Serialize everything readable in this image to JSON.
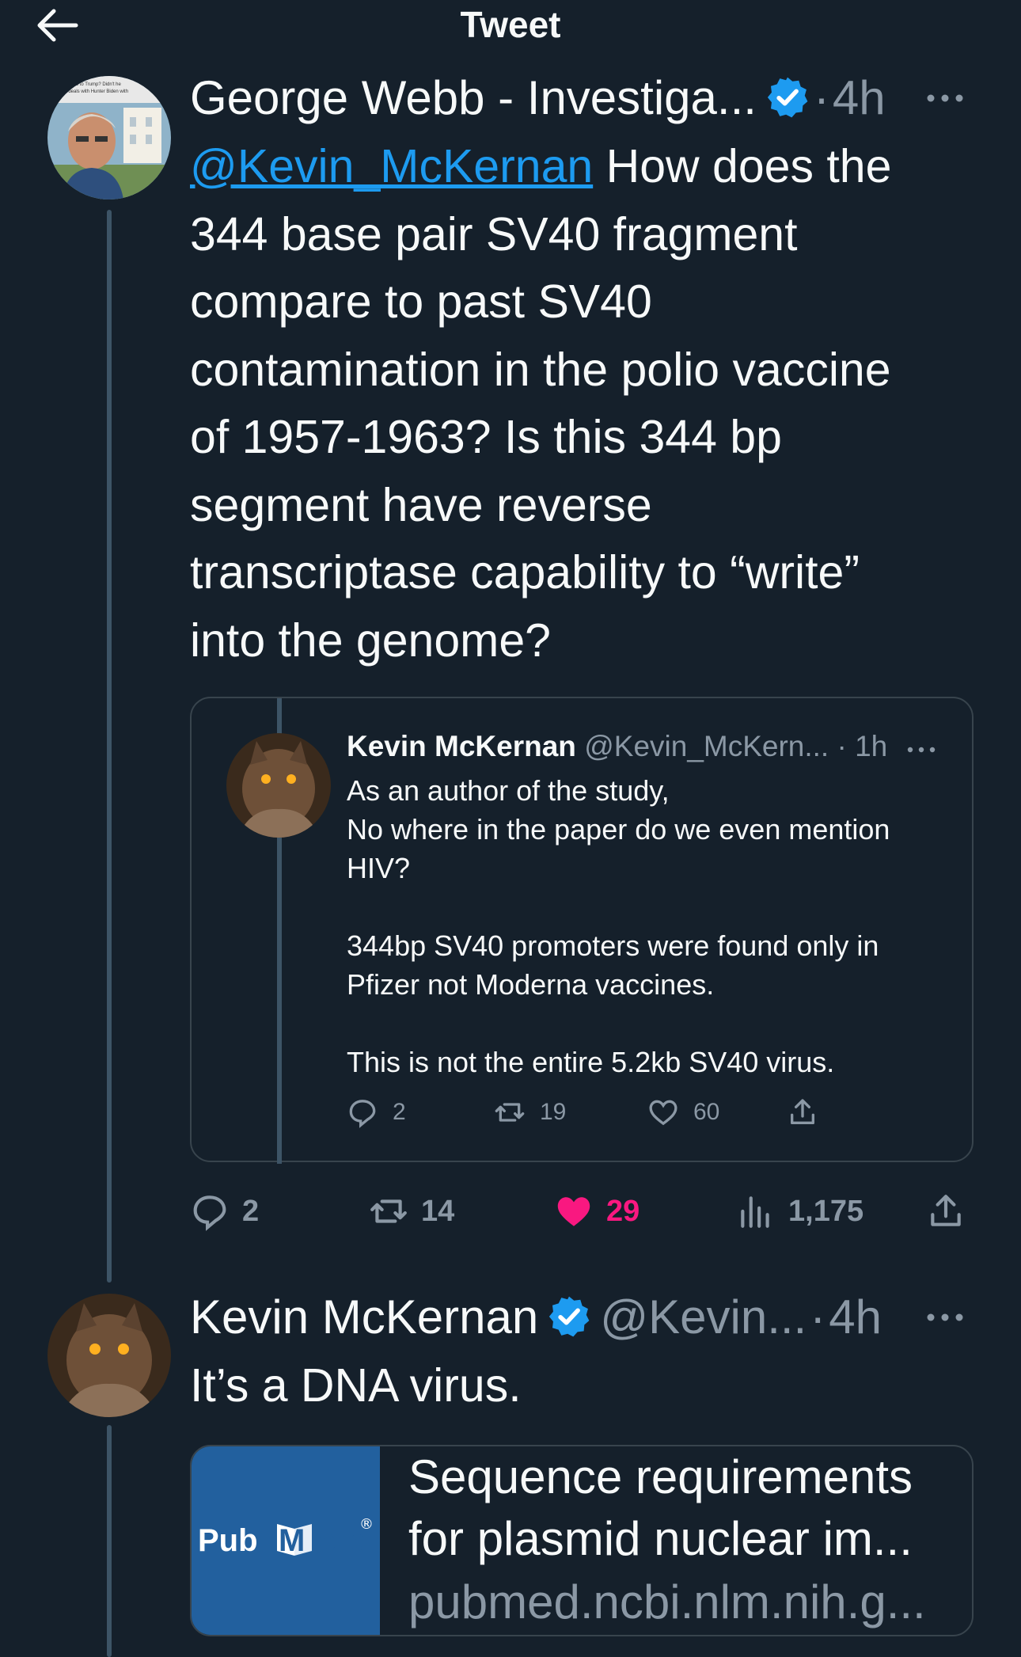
{
  "header": {
    "title": "Tweet",
    "back_icon": "arrow-left-icon"
  },
  "tweet": {
    "author_name": "George Webb - Investiga...",
    "time": "4h",
    "mention": "@Kevin_McKernan",
    "text_after_mention": "How does the",
    "lines": [
      "344 base pair SV40 fragment",
      "compare to past SV40",
      "contamination in the polio vaccine",
      "of 1957-1963?  Is this 344 bp",
      "segment have reverse",
      "transcriptase capability to “write”",
      "into the genome?"
    ],
    "avatar_caption_lines": [
      "...vine of fs to Trump? Didn't he",
      "...ens deals with Hunter Biden with",
      "..."
    ],
    "actions": {
      "replies": "2",
      "retweets": "14",
      "likes": "29",
      "views": "1,175"
    }
  },
  "quoted": {
    "author_name": "Kevin McKernan",
    "handle": "@Kevin_McKern...",
    "time": "1h",
    "lines": [
      "As an author of the study,",
      "No where in the paper do we even mention",
      "HIV?",
      "344bp SV40 promoters were found only in",
      "Pfizer not Moderna vaccines.",
      "This is not the entire 5.2kb SV40 virus."
    ],
    "actions": {
      "replies": "2",
      "retweets": "19",
      "likes": "60"
    }
  },
  "reply": {
    "author_name": "Kevin McKernan",
    "handle": "@Kevin...",
    "time": "4h",
    "text": "It’s a DNA virus.",
    "card": {
      "logo_pub": "Pub",
      "logo_med": "Med",
      "logo_reg": "®",
      "title_line1": "Sequence requirements",
      "title_line2": "for plasmid nuclear im...",
      "domain": "pubmed.ncbi.nlm.nih.g..."
    }
  },
  "colors": {
    "background": "#15202b",
    "accent": "#1d9bf0",
    "like": "#f91880",
    "muted": "#8b98a5",
    "border": "#38444d"
  }
}
